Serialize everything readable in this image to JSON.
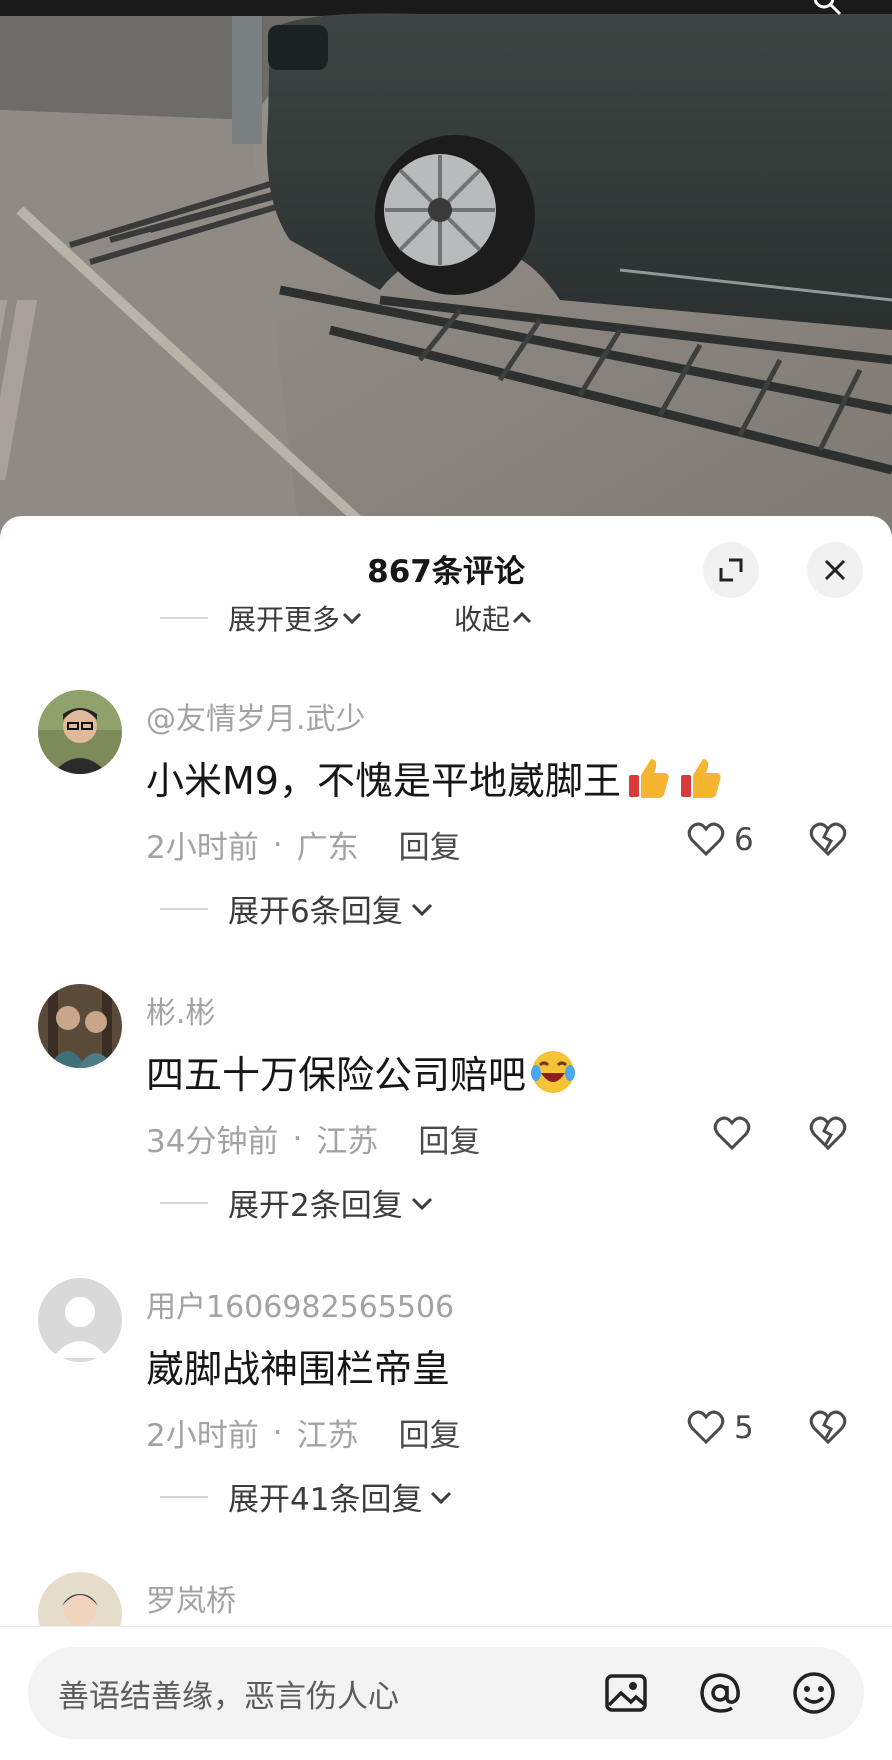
{
  "photo": {
    "description_icon": "search-icon"
  },
  "sheet": {
    "title": "867条评论",
    "expand_more": "展开更多",
    "collapse": "收起"
  },
  "comments": [
    {
      "username": "@友情岁月.武少",
      "text": "小米M9，不愧是平地崴脚王",
      "emoji": "thumbs-up-icon x2",
      "time": "2小时前",
      "location": "广东",
      "reply": "回复",
      "likes": "6",
      "expand_replies": "展开6条回复"
    },
    {
      "username": "彬.彬",
      "text": "四五十万保险公司赔吧",
      "emoji": "laughing-crying-icon",
      "time": "34分钟前",
      "location": "江苏",
      "reply": "回复",
      "likes": "",
      "expand_replies": "展开2条回复"
    },
    {
      "username": "用户1606982565506",
      "text": "崴脚战神围栏帝皇",
      "time": "2小时前",
      "location": "江苏",
      "reply": "回复",
      "likes": "5",
      "expand_replies": "展开41条回复"
    },
    {
      "username": "罗岚桥"
    }
  ],
  "input": {
    "placeholder": "善语结善缘，恶言伤人心"
  },
  "colors": {
    "muted": "#a3a3a3",
    "text": "#161616",
    "sheet_bg": "#ffffff"
  }
}
